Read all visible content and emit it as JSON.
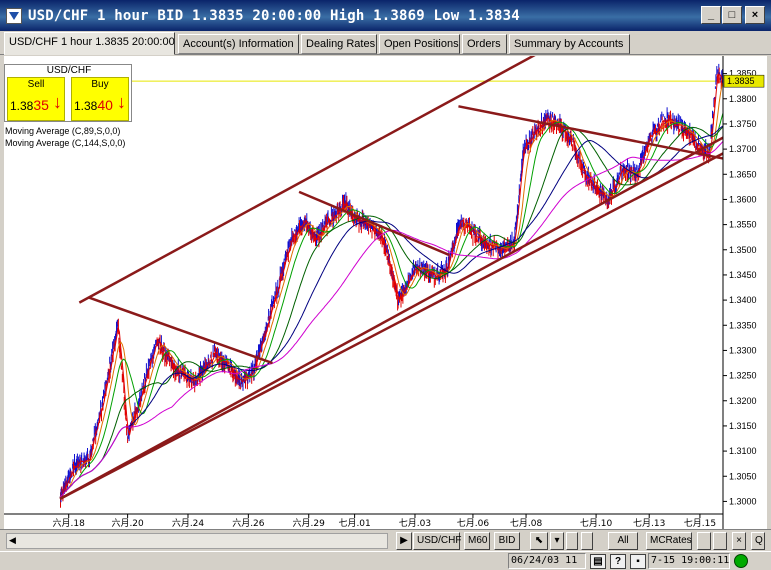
{
  "window": {
    "title": "USD/CHF 1 hour BID 1.3835 20:00:00 High 1.3869 Low 1.3834",
    "buttons": {
      "minimize": "_",
      "maximize": "□",
      "close": "×"
    }
  },
  "tabs": [
    {
      "label": "USD/CHF 1 hour 1.3835 20:00:00",
      "active": true
    },
    {
      "label": "Account(s) Information",
      "active": false
    },
    {
      "label": "Dealing Rates",
      "active": false
    },
    {
      "label": "Open Positions",
      "active": false
    },
    {
      "label": "Orders",
      "active": false
    },
    {
      "label": "Summary by Accounts",
      "active": false
    }
  ],
  "quote": {
    "symbol": "USD/CHF",
    "sell": {
      "label": "Sell",
      "price_head": "1.38",
      "price_tail": "35",
      "arrow": "↓"
    },
    "buy": {
      "label": "Buy",
      "price_head": "1.38",
      "price_tail": "40",
      "arrow": "↓"
    }
  },
  "indicators": [
    "Moving Average (C,89,S,0,0)",
    "Moving Average (C,144,S,0,0)"
  ],
  "chart_data": {
    "type": "line",
    "ylim": [
      1.2975,
      1.3885
    ],
    "current_price": "1.3835",
    "y_ticks": [
      "1.3850",
      "1.3800",
      "1.3750",
      "1.3700",
      "1.3650",
      "1.3600",
      "1.3550",
      "1.3500",
      "1.3450",
      "1.3400",
      "1.3350",
      "1.3300",
      "1.3250",
      "1.3200",
      "1.3150",
      "1.3100",
      "1.3050",
      "1.3000"
    ],
    "x_ticks": [
      "六月.18",
      "六月.20",
      "六月.24",
      "六月.26",
      "六月.29",
      "七月.01",
      "七月.03",
      "七月.06",
      "七月.08",
      "七月.10",
      "七月.13",
      "七月.15"
    ],
    "x_tick_index": [
      18,
      140,
      265,
      390,
      515,
      610,
      735,
      855,
      965,
      1110,
      1220,
      1325
    ],
    "bar_count": 1380,
    "anchors": [
      [
        0,
        1.3005
      ],
      [
        30,
        1.307
      ],
      [
        60,
        1.3085
      ],
      [
        90,
        1.32
      ],
      [
        120,
        1.335
      ],
      [
        140,
        1.313
      ],
      [
        165,
        1.32
      ],
      [
        200,
        1.332
      ],
      [
        240,
        1.326
      ],
      [
        280,
        1.324
      ],
      [
        320,
        1.329
      ],
      [
        350,
        1.327
      ],
      [
        375,
        1.324
      ],
      [
        400,
        1.326
      ],
      [
        430,
        1.335
      ],
      [
        455,
        1.344
      ],
      [
        480,
        1.352
      ],
      [
        505,
        1.356
      ],
      [
        530,
        1.352
      ],
      [
        560,
        1.356
      ],
      [
        590,
        1.359
      ],
      [
        610,
        1.356
      ],
      [
        640,
        1.355
      ],
      [
        670,
        1.352
      ],
      [
        700,
        1.34
      ],
      [
        740,
        1.347
      ],
      [
        775,
        1.345
      ],
      [
        800,
        1.346
      ],
      [
        830,
        1.356
      ],
      [
        860,
        1.353
      ],
      [
        890,
        1.351
      ],
      [
        910,
        1.35
      ],
      [
        940,
        1.351
      ],
      [
        960,
        1.37
      ],
      [
        990,
        1.374
      ],
      [
        1010,
        1.376
      ],
      [
        1030,
        1.375
      ],
      [
        1060,
        1.372
      ],
      [
        1080,
        1.366
      ],
      [
        1110,
        1.362
      ],
      [
        1135,
        1.36
      ],
      [
        1165,
        1.366
      ],
      [
        1195,
        1.365
      ],
      [
        1220,
        1.372
      ],
      [
        1250,
        1.376
      ],
      [
        1280,
        1.375
      ],
      [
        1310,
        1.372
      ],
      [
        1330,
        1.37
      ],
      [
        1345,
        1.369
      ],
      [
        1360,
        1.385
      ],
      [
        1375,
        1.3835
      ]
    ],
    "series": [
      {
        "color": "#e00000"
      },
      {
        "color": "#1010d0"
      }
    ],
    "moving_averages": [
      {
        "period": 5,
        "color": "#e00000"
      },
      {
        "period": 20,
        "color": "#e07000"
      },
      {
        "period": 40,
        "color": "#00a000"
      },
      {
        "period": 89,
        "color": "#006000"
      },
      {
        "period": 144,
        "color": "#000080"
      },
      {
        "period": 233,
        "color": "#d000d0"
      }
    ],
    "trend_lines": [
      {
        "from": [
          0,
          1.3005
        ],
        "to": [
          1660,
          1.3873
        ]
      },
      {
        "from": [
          0,
          1.3005
        ],
        "to": [
          1380,
          1.3695
        ]
      },
      {
        "from": [
          40,
          1.3395
        ],
        "to": [
          1660,
          1.424
        ]
      },
      {
        "from": [
          60,
          1.3405
        ],
        "to": [
          440,
          1.3275
        ]
      },
      {
        "from": [
          495,
          1.3615
        ],
        "to": [
          805,
          1.349
        ]
      },
      {
        "from": [
          825,
          1.3785
        ],
        "to": [
          1380,
          1.368
        ]
      }
    ],
    "horizontal_line": {
      "value": 1.3835,
      "color": "#e8e800"
    }
  },
  "bottombar": {
    "buttons": [
      {
        "name": "play-button",
        "label": "▶"
      },
      {
        "name": "symbol-button",
        "label": "USD/CHF"
      },
      {
        "name": "timeframe-button",
        "label": "M60"
      },
      {
        "name": "price-type-button",
        "label": "BID"
      },
      {
        "name": "cursor-tool-button",
        "label": "⬉"
      },
      {
        "name": "dropdown-button",
        "label": "▾"
      },
      {
        "name": "all-button",
        "label": "All"
      },
      {
        "name": "mcrates-button",
        "label": "MCRates"
      },
      {
        "name": "close-chart-button",
        "label": "×"
      },
      {
        "name": "q-button",
        "label": "Q"
      }
    ]
  },
  "status": {
    "left_time": "06/24/03 11",
    "right_time": "7-15 19:00:11"
  }
}
